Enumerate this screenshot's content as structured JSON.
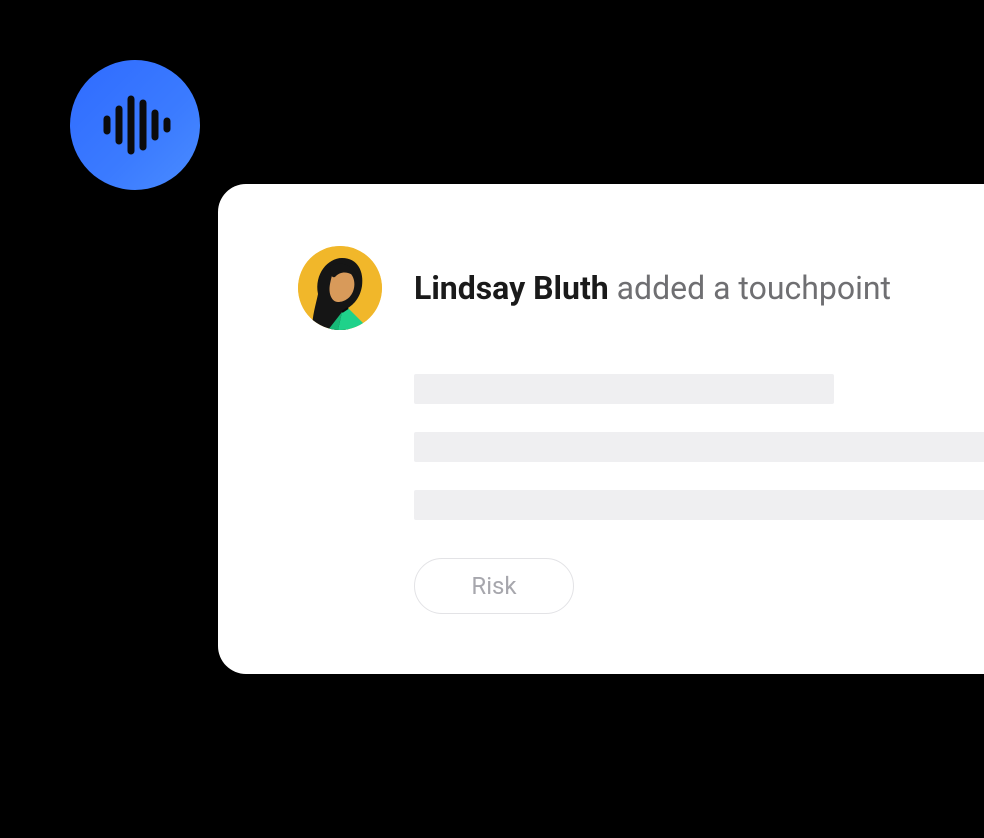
{
  "audio_badge": {
    "icon": "audio-waveform-icon"
  },
  "card": {
    "actor_name": "Lindsay Bluth",
    "action_text": "added a touchpoint",
    "tag_label": "Risk"
  },
  "colors": {
    "badge_gradient_start": "#2f6bff",
    "badge_gradient_end": "#4a8cff",
    "avatar_bg": "#f1b72a",
    "placeholder": "#efeff1",
    "pill_border": "#e3e3e6",
    "text_muted": "#6f6f72"
  }
}
